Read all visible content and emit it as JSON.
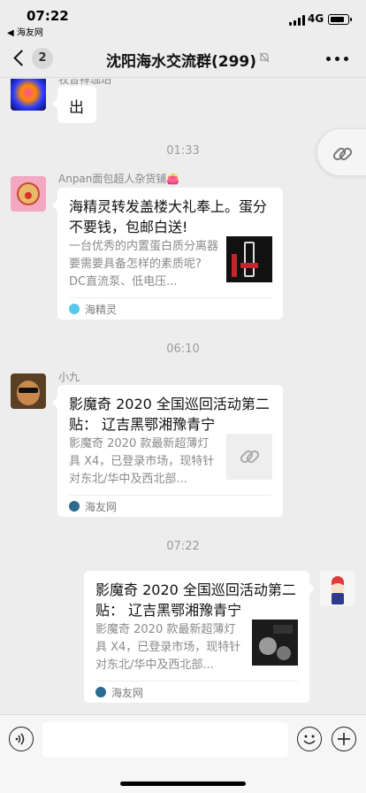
{
  "status_bar": {
    "time": "07:22",
    "back_app": "◀ 海友网",
    "network": "4G",
    "battery_level": 0.85
  },
  "nav": {
    "unread_count": "2",
    "title": "沈阳海水交流群(299)"
  },
  "messages": [
    {
      "type": "text",
      "sender": "牧音祥珈珀",
      "text": "出"
    },
    {
      "type": "time",
      "text": "01:33"
    },
    {
      "type": "card",
      "sender": "Anpan面包超人杂货铺👛",
      "title": "海精灵转发盖楼大礼奉上。蛋分不要钱，包邮白送!",
      "desc": "一台优秀的内置蛋白质分离器要需要具备怎样的素质呢? DC直流泵、低电压...",
      "source": "海精灵",
      "thumb": "skimmer-photo"
    },
    {
      "type": "time",
      "text": "06:10"
    },
    {
      "type": "card",
      "sender": "小九",
      "title": "影魔奇 2020 全国巡回活动第二贴：  辽吉黑鄂湘豫青宁",
      "desc": "影魔奇 2020 款最新超薄灯具 X4，已登录市场，现特针对东北/华中及西北部...",
      "source": "海友网",
      "thumb": "link-icon"
    },
    {
      "type": "time",
      "text": "07:22"
    },
    {
      "type": "card",
      "sender": "",
      "title": "影魔奇 2020 全国巡回活动第二贴：  辽吉黑鄂湘豫青宁",
      "desc": "影魔奇 2020 款最新超薄灯具 X4，已登录市场，现特针对东北/华中及西北部...",
      "source": "海友网",
      "thumb": "lamp-photo"
    }
  ],
  "colors": {
    "background": "#ededed",
    "bubble": "#ffffff",
    "muted_text": "#888888"
  }
}
